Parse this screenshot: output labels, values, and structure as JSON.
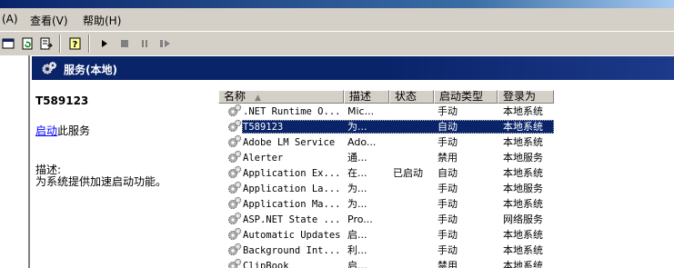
{
  "menu": {
    "action": "(A)",
    "view": "查看(V)",
    "help": "帮助(H)"
  },
  "toolbar": {
    "icons": [
      "view-icon",
      "refresh-icon",
      "export-icon",
      "help-icon",
      "play-icon",
      "stop-icon",
      "pause-icon",
      "restart-icon"
    ]
  },
  "header": {
    "title": "服务(本地)"
  },
  "details": {
    "service_name": "T589123",
    "start_link": "启动",
    "start_suffix": "此服务",
    "description_label": "描述:",
    "description_text": "为系统提供加速启动功能。"
  },
  "columns": [
    "名称",
    "描述",
    "状态",
    "启动类型",
    "登录为"
  ],
  "sort_indicator": "▲",
  "services": [
    {
      "name": ".NET Runtime O...",
      "desc": "Mic...",
      "status": "",
      "startup": "手动",
      "logon": "本地系统"
    },
    {
      "name": "T589123",
      "desc": "为...",
      "status": "",
      "startup": "自动",
      "logon": "本地系统",
      "selected": true
    },
    {
      "name": "Adobe LM Service",
      "desc": "Ado...",
      "status": "",
      "startup": "手动",
      "logon": "本地系统"
    },
    {
      "name": "Alerter",
      "desc": "通...",
      "status": "",
      "startup": "禁用",
      "logon": "本地服务"
    },
    {
      "name": "Application Ex...",
      "desc": "在...",
      "status": "已启动",
      "startup": "自动",
      "logon": "本地系统"
    },
    {
      "name": "Application La...",
      "desc": "为...",
      "status": "",
      "startup": "手动",
      "logon": "本地服务"
    },
    {
      "name": "Application Ma...",
      "desc": "为...",
      "status": "",
      "startup": "手动",
      "logon": "本地系统"
    },
    {
      "name": "ASP.NET State ...",
      "desc": "Pro...",
      "status": "",
      "startup": "手动",
      "logon": "网络服务"
    },
    {
      "name": "Automatic Updates",
      "desc": "启...",
      "status": "",
      "startup": "手动",
      "logon": "本地系统"
    },
    {
      "name": "Background Int...",
      "desc": "利...",
      "status": "",
      "startup": "手动",
      "logon": "本地系统"
    },
    {
      "name": "ClipBook",
      "desc": "启...",
      "status": "",
      "startup": "禁用",
      "logon": "本地系统"
    }
  ]
}
